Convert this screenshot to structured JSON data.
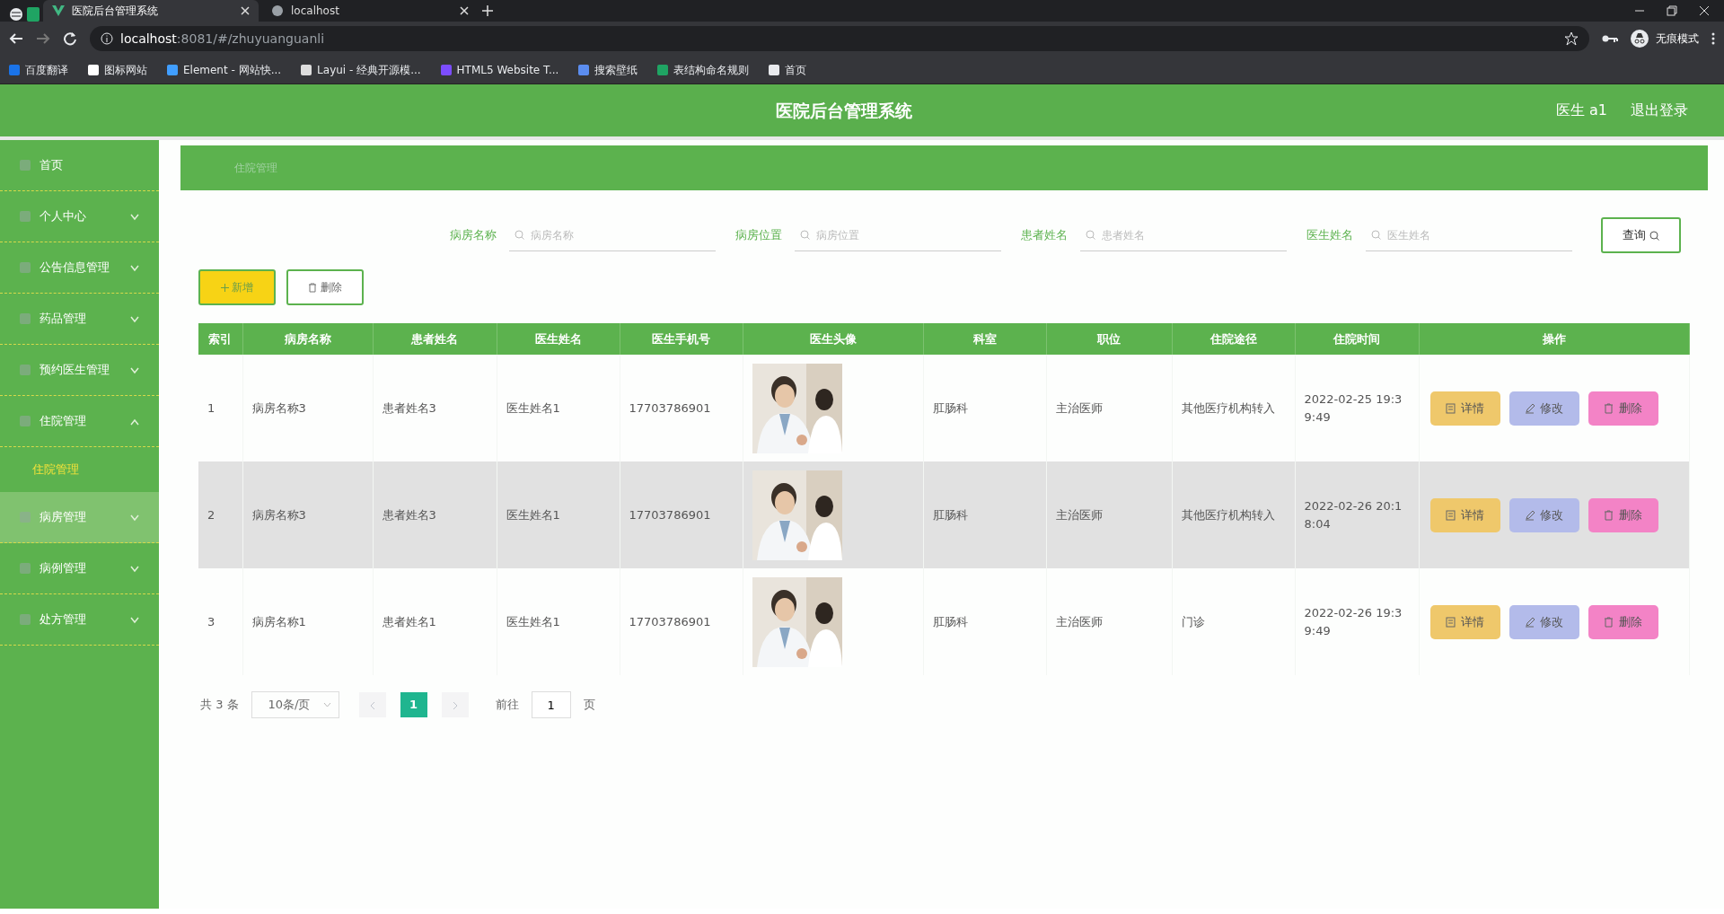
{
  "browser": {
    "tabs": [
      {
        "title": "医院后台管理系统",
        "selected": true
      },
      {
        "title": "localhost",
        "selected": false
      }
    ],
    "address_host": "localhost",
    "address_rest": ":8081/#/zhuyuanguanli",
    "bookmarks": [
      "百度翻译",
      "图标网站",
      "Element - 网站快...",
      "Layui - 经典开源模...",
      "HTML5 Website T...",
      "搜索壁纸",
      "表结构命名规则",
      "首页"
    ],
    "profile": "无痕模式"
  },
  "header": {
    "title": "医院后台管理系统",
    "user": "医生 a1",
    "logout": "退出登录"
  },
  "sidebar": {
    "items": [
      {
        "label": "首页",
        "hovered": false
      },
      {
        "label": "个人中心",
        "expanded": false,
        "hovered": false
      },
      {
        "label": "公告信息管理",
        "expanded": false,
        "hovered": false
      },
      {
        "label": "药品管理",
        "expanded": false,
        "hovered": false
      },
      {
        "label": "预约医生管理",
        "expanded": false,
        "hovered": false
      },
      {
        "label": "住院管理",
        "expanded": true,
        "hovered": false,
        "children": [
          {
            "label": "住院管理",
            "selected": true
          }
        ]
      },
      {
        "label": "病房管理",
        "expanded": false,
        "hovered": true
      },
      {
        "label": "病例管理",
        "expanded": false,
        "hovered": false
      },
      {
        "label": "处方管理",
        "expanded": false,
        "hovered": false
      }
    ]
  },
  "breadcrumb": "住院管理",
  "search": {
    "fields": [
      {
        "label": "病房名称",
        "placeholder": "病房名称"
      },
      {
        "label": "病房位置",
        "placeholder": "病房位置"
      },
      {
        "label": "患者姓名",
        "placeholder": "患者姓名"
      },
      {
        "label": "医生姓名",
        "placeholder": "医生姓名"
      }
    ],
    "button": "查询"
  },
  "toolbar": {
    "add": "新增",
    "delete": "删除"
  },
  "table": {
    "columns": [
      "索引",
      "病房名称",
      "患者姓名",
      "医生姓名",
      "医生手机号",
      "医生头像",
      "科室",
      "职位",
      "住院途径",
      "住院时间",
      "操作"
    ],
    "rows": [
      {
        "hovered": false,
        "cells": [
          "1",
          "病房名称3",
          "患者姓名3",
          "医生姓名1",
          "17703786901",
          null,
          "肛肠科",
          "主治医师",
          "其他医疗机构转入",
          "2022-02-25 19:39:49"
        ],
        "actions": [
          "详情",
          "修改",
          "删除"
        ]
      },
      {
        "hovered": true,
        "cells": [
          "2",
          "病房名称3",
          "患者姓名3",
          "医生姓名1",
          "17703786901",
          null,
          "肛肠科",
          "主治医师",
          "其他医疗机构转入",
          "2022-02-26 20:18:04"
        ],
        "actions": [
          "详情",
          "修改",
          "删除"
        ]
      },
      {
        "hovered": false,
        "cells": [
          "3",
          "病房名称1",
          "患者姓名1",
          "医生姓名1",
          "17703786901",
          null,
          "肛肠科",
          "主治医师",
          "门诊",
          "2022-02-26 19:39:49"
        ],
        "actions": [
          "详情",
          "修改",
          "删除"
        ]
      }
    ]
  },
  "pagination": {
    "total": "共 3 条",
    "page_size": "10条/页",
    "pages": [
      {
        "label": "1",
        "selected": true
      }
    ],
    "goto": "前往",
    "goto_value": "1",
    "page_word": "页"
  }
}
